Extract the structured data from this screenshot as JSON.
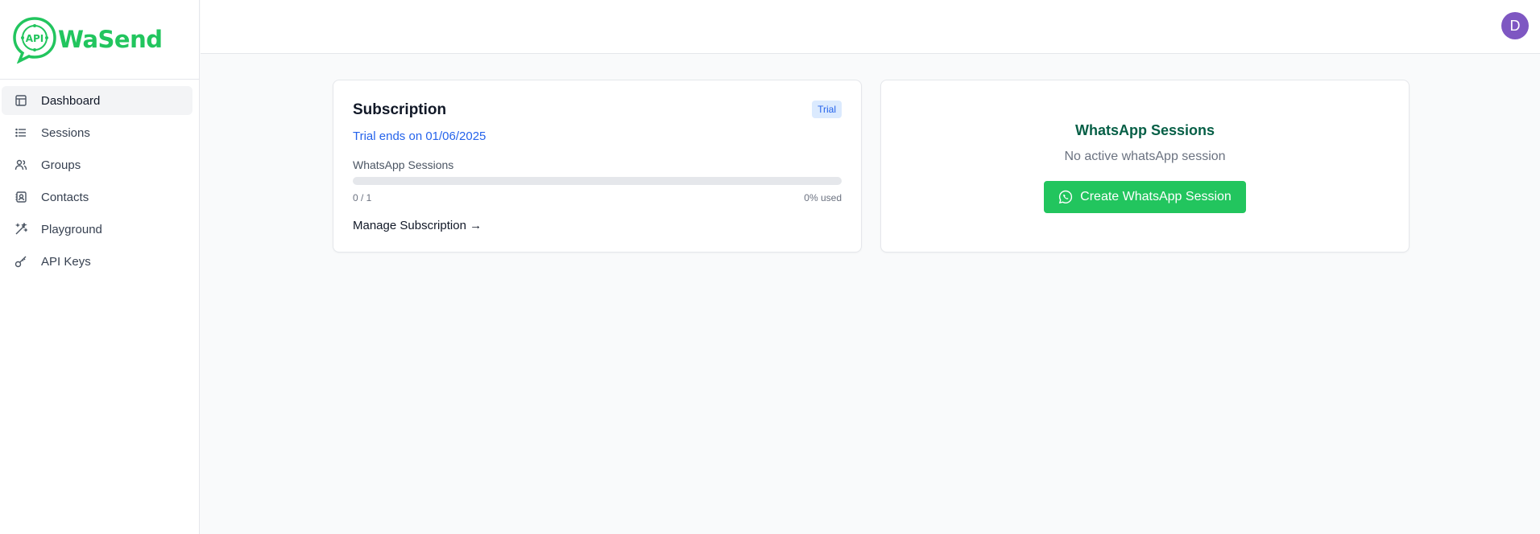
{
  "brand": {
    "name": "WaSend",
    "logo_text": "API",
    "color": "#22c55e"
  },
  "sidebar": {
    "items": [
      {
        "label": "Dashboard",
        "icon": "layout-icon",
        "active": true
      },
      {
        "label": "Sessions",
        "icon": "list-icon"
      },
      {
        "label": "Groups",
        "icon": "users-icon"
      },
      {
        "label": "Contacts",
        "icon": "contact-book-icon"
      },
      {
        "label": "Playground",
        "icon": "magic-wand-icon"
      },
      {
        "label": "API Keys",
        "icon": "key-icon"
      }
    ]
  },
  "header": {
    "avatar_initial": "D",
    "avatar_color": "#7e57c2"
  },
  "subscription": {
    "title": "Subscription",
    "badge": "Trial",
    "trial_ends": "Trial ends on 01/06/2025",
    "usage_label": "WhatsApp Sessions",
    "usage_count": "0 / 1",
    "usage_percent_text": "0% used",
    "usage_fraction": 0,
    "manage_link": "Manage Subscription →"
  },
  "whatsapp": {
    "title": "WhatsApp Sessions",
    "empty_text": "No active whatsApp session",
    "create_button": "Create WhatsApp Session"
  }
}
